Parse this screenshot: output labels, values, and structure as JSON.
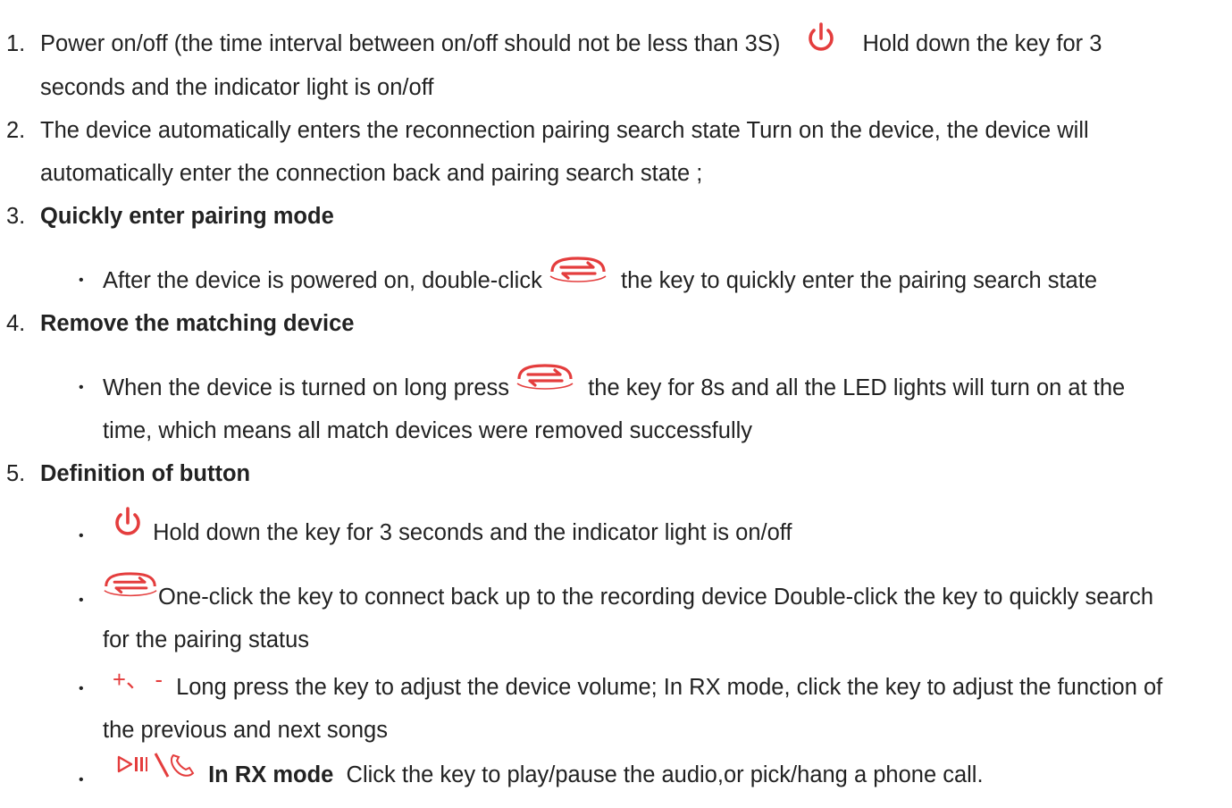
{
  "items": [
    {
      "num": "1.",
      "part1": "Power on/off (the time interval between on/off should not be less than 3S)",
      "part2": "Hold down the key for 3",
      "cont": "seconds and the indicator light is on/off"
    },
    {
      "num": "2.",
      "text": "The device automatically enters the reconnection pairing search state Turn on the device, the device will",
      "cont": "automatically enter the connection back and pairing search state ;"
    },
    {
      "num": "3.",
      "heading": "Quickly enter pairing mode",
      "bullet": {
        "before": "After the device is powered on, double-click",
        "after": "the key to quickly enter the pairing search state"
      }
    },
    {
      "num": "4.",
      "heading": "Remove the matching device",
      "bullet": {
        "before": "When the device is turned on  long press",
        "after": "the key for 8s  and all the LED lights will turn on at the",
        "cont": "time, which means all match devices were removed successfully"
      }
    },
    {
      "num": "5.",
      "heading": "Definition of button"
    }
  ],
  "buttons": [
    {
      "text": "Hold down the key for 3 seconds and the indicator light is on/off"
    },
    {
      "text": "One-click the key to connect back up to the recording device Double-click the key to quickly search",
      "cont": "for the pairing status"
    },
    {
      "glyph": "+、 -",
      "text": "Long press the key to adjust the device volume; In RX mode, click the key to adjust the function of",
      "cont": "the previous and next songs"
    },
    {
      "bold": "In RX mode",
      "text": "  Click the key to play/pause the audio,or pick/hang a phone call."
    }
  ],
  "bullet_glyph": "•",
  "colors": {
    "text": "#222222",
    "icon": "#e43d3d"
  },
  "icons": [
    "power-icon",
    "pair-switch-icon",
    "volume-plus-minus-icon",
    "play-pause-call-icon"
  ]
}
